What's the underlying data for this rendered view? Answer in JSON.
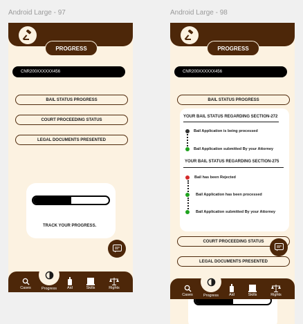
{
  "frames": [
    {
      "label": "Android Large - 97",
      "title": "PROGRESS",
      "cnr": "CNR200XXXXXX456",
      "options": [
        "BAIL STATUS PROGRESS",
        "COURT PROCEEDING STATUS",
        "LEGAL DOCUMENTS PRESENTED"
      ],
      "track_label": "TRACK YOUR PROGRESS.",
      "progress_fraction": 0.5,
      "nav": [
        "Cases",
        "Progress",
        "Aid",
        "Skills",
        "Rights"
      ]
    },
    {
      "label": "Android Large - 98",
      "title": "PROGRESS",
      "cnr": "CNR200XXXXXX456",
      "bail_option": "BAIL STATUS PROGRESS",
      "section272": {
        "heading": "YOUR BAIL STATUS  REGARDING  SECTION-272",
        "steps": [
          "Bail Application is being processed",
          "Bail Application submitted By your Attorney"
        ]
      },
      "section275": {
        "heading": "YOUR BAIL STATUS  REGARDING  SECTION-275",
        "steps": [
          "Bail has been Rejected",
          "Bail Application has been processed",
          "Bail Application submitted By your Attorney"
        ]
      },
      "options_after": [
        "COURT PROCEEDING STATUS",
        "LEGAL DOCUMENTS PRESENTED"
      ],
      "nav": [
        "Cases",
        "Progress",
        "Aid",
        "Skills",
        "Rights"
      ]
    }
  ],
  "colors": {
    "brown": "#4d2709",
    "cream": "#fcf2e1",
    "red": "#d42a2a",
    "green": "#1fa31f",
    "dark": "#333333"
  }
}
